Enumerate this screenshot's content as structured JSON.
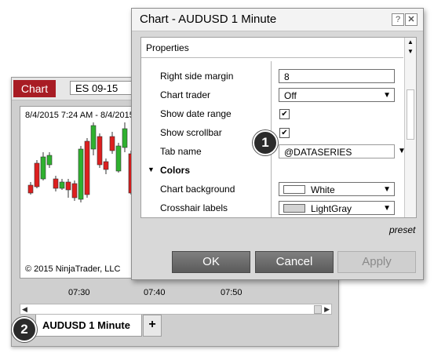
{
  "chart_window": {
    "tab_label": "Chart",
    "instrument": "ES 09-15",
    "range_label": "8/4/2015 7:24 AM - 8/4/2015",
    "copyright": "© 2015 NinjaTrader, LLC",
    "time_ticks": [
      "07:30",
      "07:40",
      "07:50"
    ],
    "bottom_tab": "AUDUSD 1 Minute",
    "add_tab": "+",
    "colors": {
      "up": "#2fb12f",
      "down": "#dd1f1f",
      "tab": "#a81c24"
    }
  },
  "dialog": {
    "title": "Chart - AUDUSD 1 Minute",
    "help_label": "?",
    "close_label": "✕",
    "section_header": "Properties",
    "rows": [
      {
        "name": "Right side margin",
        "value": "8"
      },
      {
        "name": "Chart trader",
        "value": "Off"
      },
      {
        "name": "Show date range"
      },
      {
        "name": "Show scrollbar"
      },
      {
        "name": "Tab name",
        "value": "@DATASERIES"
      },
      {
        "section": "Colors"
      },
      {
        "name": "Chart background",
        "value": "White",
        "swatch": "#ffffff"
      },
      {
        "name": "Crosshair labels",
        "value": "LightGray",
        "swatch": "#d3d3d3"
      }
    ],
    "preset_label": "preset",
    "buttons": {
      "ok": "OK",
      "cancel": "Cancel",
      "apply": "Apply"
    }
  },
  "callouts": {
    "one": "1",
    "two": "2"
  }
}
